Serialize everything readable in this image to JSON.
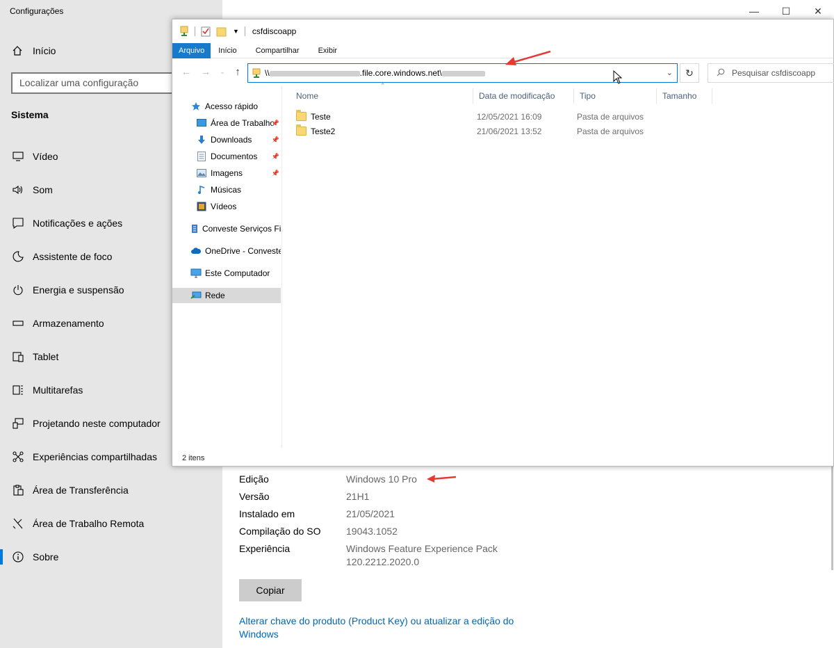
{
  "settings": {
    "title": "Configurações",
    "home_label": "Início",
    "search_placeholder": "Localizar uma configuração",
    "section_title": "Sistema",
    "nav": [
      {
        "label": "Vídeo",
        "icon": "monitor-icon"
      },
      {
        "label": "Som",
        "icon": "speaker-icon"
      },
      {
        "label": "Notificações e ações",
        "icon": "notification-icon"
      },
      {
        "label": "Assistente de foco",
        "icon": "moon-icon"
      },
      {
        "label": "Energia e suspensão",
        "icon": "power-icon"
      },
      {
        "label": "Armazenamento",
        "icon": "storage-icon"
      },
      {
        "label": "Tablet",
        "icon": "tablet-icon"
      },
      {
        "label": "Multitarefas",
        "icon": "multitask-icon"
      },
      {
        "label": "Projetando neste computador",
        "icon": "project-icon"
      },
      {
        "label": "Experiências compartilhadas",
        "icon": "share-icon"
      },
      {
        "label": "Área de Transferência",
        "icon": "clipboard-icon"
      },
      {
        "label": "Área de Trabalho Remota",
        "icon": "remote-icon"
      },
      {
        "label": "Sobre",
        "icon": "info-icon",
        "active": true
      }
    ],
    "specs": [
      {
        "label": "Edição",
        "value": "Windows 10 Pro"
      },
      {
        "label": "Versão",
        "value": "21H1"
      },
      {
        "label": "Instalado em",
        "value": "21/05/2021"
      },
      {
        "label": "Compilação do SO",
        "value": "19043.1052"
      },
      {
        "label": "Experiência",
        "value": "Windows Feature Experience Pack 120.2212.2020.0"
      }
    ],
    "copy_label": "Copiar",
    "product_link": "Alterar chave do produto (Product Key) ou atualizar a edição do Windows"
  },
  "explorer": {
    "title": "csfdiscoapp",
    "ribbon_tabs": [
      "Arquivo",
      "Início",
      "Compartilhar",
      "Exibir"
    ],
    "address_prefix": "\\\\",
    "address_visible": ".file.core.windows.net\\",
    "search_placeholder": "Pesquisar csfdiscoapp",
    "columns": [
      "Nome",
      "Data de modificação",
      "Tipo",
      "Tamanho"
    ],
    "tree": [
      {
        "label": "Acesso rápido",
        "icon": "star-icon",
        "pinned": false
      },
      {
        "label": "Área de Trabalho",
        "icon": "desktop-icon",
        "pinned": true
      },
      {
        "label": "Downloads",
        "icon": "download-icon",
        "pinned": true
      },
      {
        "label": "Documentos",
        "icon": "document-icon",
        "pinned": true
      },
      {
        "label": "Imagens",
        "icon": "pictures-icon",
        "pinned": true
      },
      {
        "label": "Músicas",
        "icon": "music-icon",
        "pinned": false
      },
      {
        "label": "Vídeos",
        "icon": "video-icon",
        "pinned": false
      },
      {
        "label": "Conveste Serviços Fir",
        "icon": "building-icon",
        "pinned": false
      },
      {
        "label": "OneDrive - Conveste",
        "icon": "cloud-icon",
        "pinned": false
      },
      {
        "label": "Este Computador",
        "icon": "computer-icon",
        "pinned": false
      },
      {
        "label": "Rede",
        "icon": "network-icon",
        "pinned": false,
        "selected": true
      }
    ],
    "files": [
      {
        "name": "Teste",
        "date": "12/05/2021 16:09",
        "type": "Pasta de arquivos"
      },
      {
        "name": "Teste2",
        "date": "21/06/2021 13:52",
        "type": "Pasta de arquivos"
      }
    ],
    "status": "2 itens"
  }
}
